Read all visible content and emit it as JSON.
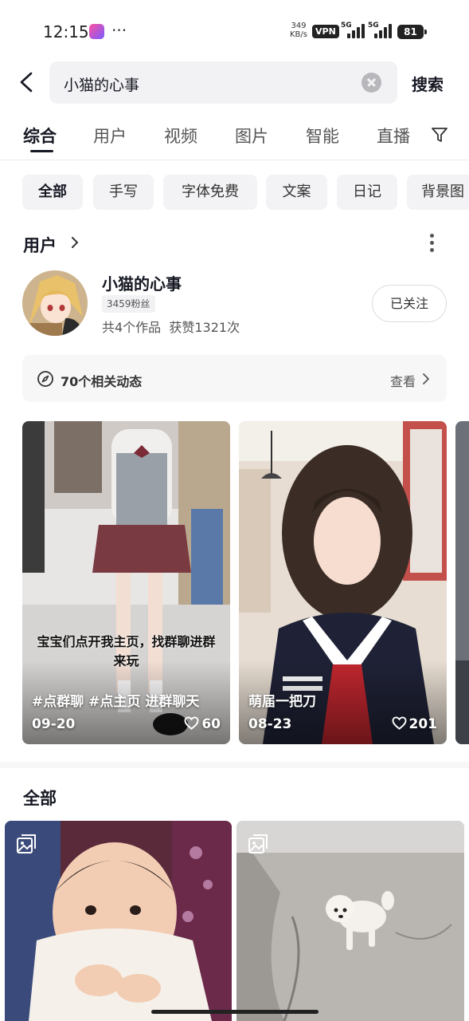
{
  "status_bar": {
    "time": "12:15",
    "dots": "···",
    "net_speed_value": "349",
    "net_speed_unit": "KB/s",
    "vpn": "VPN",
    "signal1": "5G",
    "signal2": "5G",
    "battery": "81"
  },
  "search": {
    "query": "小猫的心事",
    "button": "搜索"
  },
  "tabs": [
    "综合",
    "用户",
    "视频",
    "图片",
    "智能",
    "直播"
  ],
  "chips": [
    "全部",
    "手写",
    "字体免费",
    "文案",
    "日记",
    "背景图"
  ],
  "user_section": {
    "title": "用户",
    "user": {
      "name": "小猫的心事",
      "fans": "3459粉丝",
      "stats": "共4个作品  获赞1321次",
      "follow_button": "已关注"
    },
    "related": {
      "text": "70个相关动态",
      "view": "查看"
    }
  },
  "videos": [
    {
      "caption_line1": "宝宝们点开我主页，找群聊进群",
      "caption_line2": "来玩",
      "tags": "#点群聊 #点主页 进群聊天",
      "date": "09-20",
      "likes": "60"
    },
    {
      "caption_line1": "",
      "caption_line2": "",
      "tags": "萌届一把刀",
      "date": "08-23",
      "likes": "201"
    }
  ],
  "all_section": {
    "title": "全部"
  },
  "colors": {
    "text_primary": "#161823",
    "chip_bg": "#f3f3f5",
    "search_bg": "#f2f2f4"
  }
}
